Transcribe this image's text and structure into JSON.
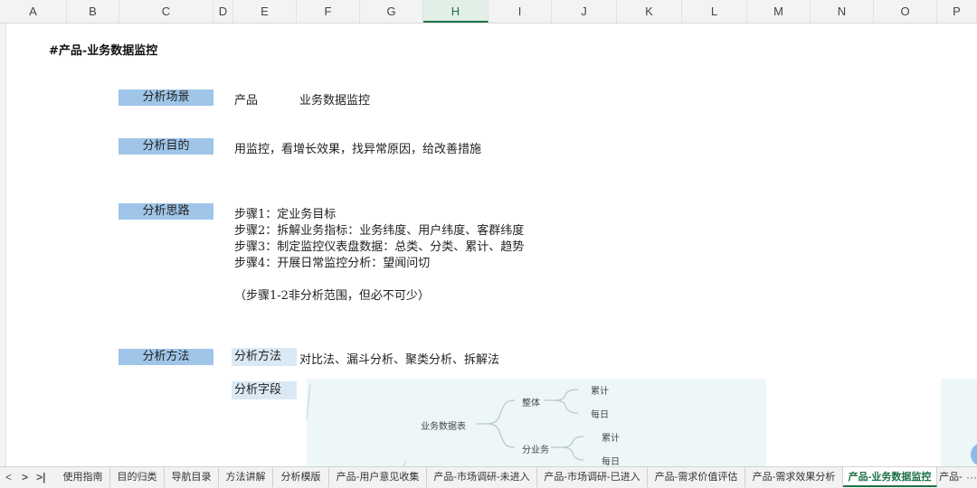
{
  "columns": [
    "A",
    "B",
    "C",
    "D",
    "E",
    "F",
    "G",
    "H",
    "I",
    "J",
    "K",
    "L",
    "M",
    "N",
    "O",
    "P"
  ],
  "selected_column": "H",
  "sheet": {
    "title": "#产品-业务数据监控",
    "scene_label": "分析场景",
    "scene_value_1": "产品",
    "scene_value_2": "业务数据监控",
    "purpose_label": "分析目的",
    "purpose_value": "用监控，看增长效果，找异常原因，给改善措施",
    "approach_label": "分析思路",
    "steps": [
      "步骤1：定业务目标",
      "步骤2：拆解业务指标：业务纬度、用户纬度、客群纬度",
      "步骤3：制定监控仪表盘数据：总类、分类、累计、趋势",
      "步骤4：开展日常监控分析：望闻问切"
    ],
    "approach_note": "（步骤1-2非分析范围，但必不可少）",
    "method_label": "分析方法",
    "method_sub_label": "分析方法",
    "method_value": "对比法、漏斗分析、聚类分析、拆解法",
    "field_label": "分析字段"
  },
  "mindmap": {
    "root": "业务数据表",
    "branch_overall": "整体",
    "branch_by_business": "分业务",
    "leaf_cumulative_1": "累计",
    "leaf_daily_1": "每日",
    "leaf_cumulative_2": "累计",
    "leaf_daily_2": "每日"
  },
  "tabs": {
    "nav_prev": "<",
    "nav_next": ">",
    "nav_last": ">|",
    "items": [
      "使用指南",
      "目的归类",
      "导航目录",
      "方法讲解",
      "分析模版",
      "产品-用户意见收集",
      "产品-市场调研-未进入",
      "产品-市场调研-已进入",
      "产品-需求价值评估",
      "产品-需求效果分析",
      "产品-业务数据监控",
      "产品-",
      "···"
    ],
    "active": "产品-业务数据监控"
  },
  "colors": {
    "label_fill": "#9fc5e8",
    "sublabel_fill": "#dbe9f5",
    "active_accent": "#1e7145",
    "mindmap_bg": "#eef7f8"
  }
}
